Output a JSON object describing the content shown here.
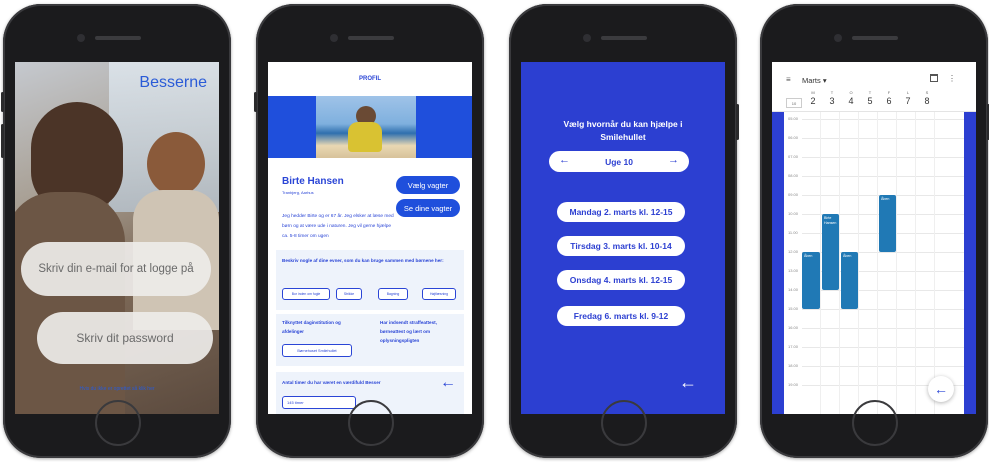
{
  "colors": {
    "brand_blue": "#1f4fdc",
    "screen_blue": "#2c3fd1",
    "event_blue": "#2079b5",
    "phone_frame": "#1b1b1d"
  },
  "login": {
    "title": "Besserne",
    "email_placeholder": "Skriv din e-mail for at logge på",
    "password_placeholder": "Skriv dit password",
    "forgot_link": "Hvis du ikke er oprettet så klik her"
  },
  "profile": {
    "header": "PROFIL",
    "name": "Birte Hansen",
    "location": "Tranbjerg, Aarhus",
    "choose_shifts_button": "Vælg vagter",
    "my_shifts_button": "Se dine vagter",
    "bio": "Jeg hedder Birte og er 67 år. Jeg elsker at læse med børn og at være ude i naturen. Jeg vil gerne hjælpe ca. 5-8 timer om ugen",
    "skills_prompt": "Beskriv nogle af dine evner, som du kan bruge sammen med børnene her:",
    "skills": [
      "Bor inden om fugle",
      "Strikke",
      "Bagning",
      "Højtlæsning"
    ],
    "institution_label": "Tilknyttet daginstitution og afdelinger",
    "institution_value": "Børnehuset Smilehullet",
    "criminal_record_note": "Har indsendt straffeattest, børneattest og lært om oplysningspligten",
    "hours_label": "Antal timer du har været en værdifuld Besser",
    "hours_value": "145 timer"
  },
  "shifts": {
    "question": "Vælg hvornår du kan hjælpe i Smilehullet",
    "week_label": "Uge 10",
    "days": [
      "Mandag 2. marts kl. 12-15",
      "Tirsdag 3. marts kl. 10-14",
      "Onsdag 4. marts kl. 12-15",
      "Fredag 6. marts kl. 9-12"
    ]
  },
  "calendar": {
    "month": "Marts",
    "week_number": "10",
    "weekdays": [
      "M",
      "T",
      "O",
      "T",
      "F",
      "L",
      "S"
    ],
    "dates": [
      "2",
      "3",
      "4",
      "5",
      "6",
      "7",
      "8"
    ],
    "hours": [
      "05.00",
      "06.00",
      "07.00",
      "08.00",
      "09.00",
      "10.00",
      "11.00",
      "12.00",
      "13.00",
      "14.00",
      "15.00",
      "16.00",
      "17.00",
      "18.00",
      "19.00"
    ],
    "events": {
      "monday": "Åben",
      "tuesday": "Birte Hansen",
      "wednesday": "Åben",
      "friday": "Åben"
    }
  }
}
